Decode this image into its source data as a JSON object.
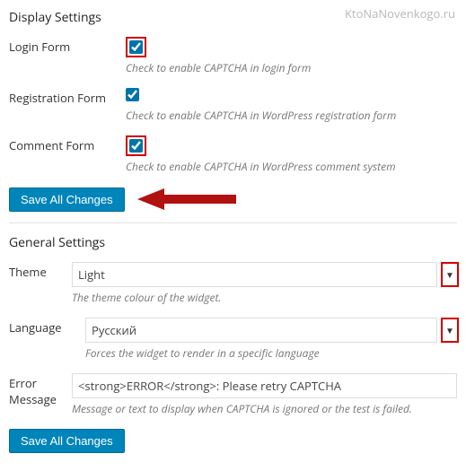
{
  "watermark": "KtoNaNovenkogo.ru",
  "display": {
    "heading": "Display Settings",
    "login": {
      "label": "Login Form",
      "hint": "Check to enable CAPTCHA in login form",
      "checked": true
    },
    "registration": {
      "label": "Registration Form",
      "hint": "Check to enable CAPTCHA in WordPress registration form",
      "checked": true
    },
    "comment": {
      "label": "Comment Form",
      "hint": "Check to enable CAPTCHA in WordPress comment system",
      "checked": true
    }
  },
  "save_button": "Save All Changes",
  "general": {
    "heading": "General Settings",
    "theme": {
      "label": "Theme",
      "value": "Light",
      "hint": "The theme colour of the widget."
    },
    "language": {
      "label": "Language",
      "value": "Русский",
      "hint": "Forces the widget to render in a specific language"
    },
    "error": {
      "label": "Error Message",
      "value": "<strong>ERROR</strong>: Please retry CAPTCHA",
      "hint": "Message or text to display when CAPTCHA is ignored or the test is failed."
    }
  }
}
